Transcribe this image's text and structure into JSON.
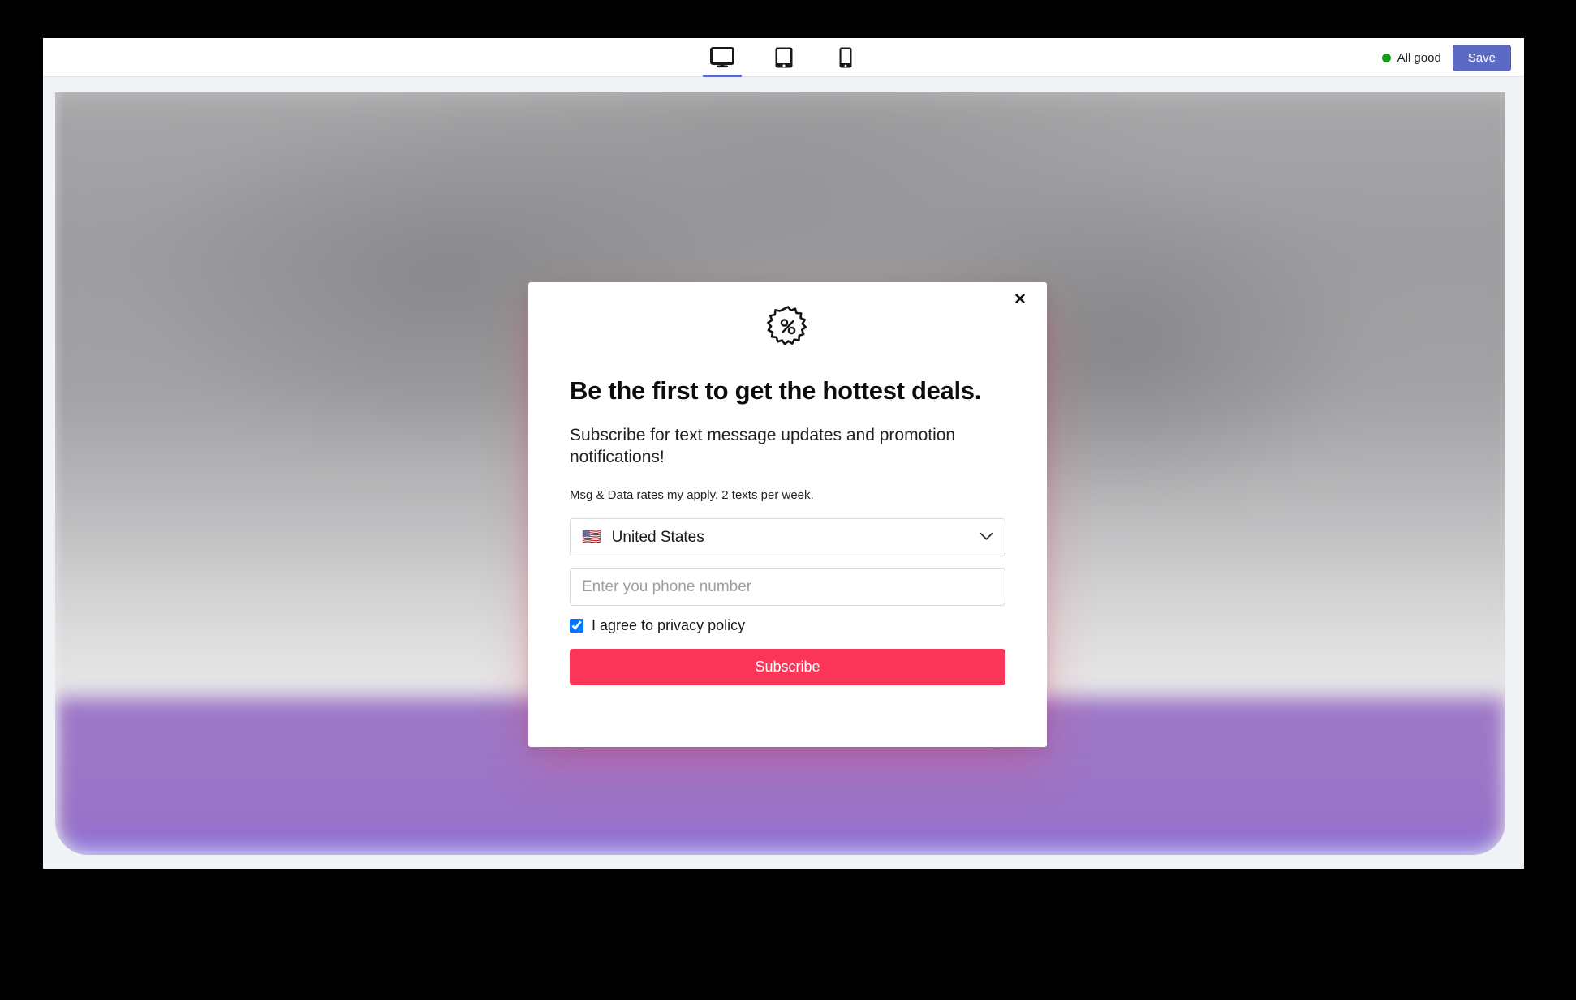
{
  "toolbar": {
    "devices": [
      {
        "name": "desktop",
        "icon": "desktop-icon",
        "active": true
      },
      {
        "name": "tablet",
        "icon": "tablet-icon",
        "active": false
      },
      {
        "name": "mobile",
        "icon": "mobile-icon",
        "active": false
      }
    ],
    "status_label": "All good",
    "status_color": "#169c16",
    "save_label": "Save",
    "save_color": "#5c6ac4"
  },
  "modal": {
    "close_label": "✕",
    "icon": "percent-badge-icon",
    "title": "Be the first to get the hottest deals.",
    "subtitle": "Subscribe for text message updates and promotion notifications!",
    "fineprint": "Msg & Data rates my apply. 2 texts per week.",
    "country": {
      "flag": "🇺🇸",
      "value": "United States"
    },
    "phone": {
      "value": "",
      "placeholder": "Enter you phone number"
    },
    "consent": {
      "label": "I agree to privacy policy",
      "checked": true
    },
    "submit_label": "Subscribe",
    "submit_color": "#fb3557"
  }
}
